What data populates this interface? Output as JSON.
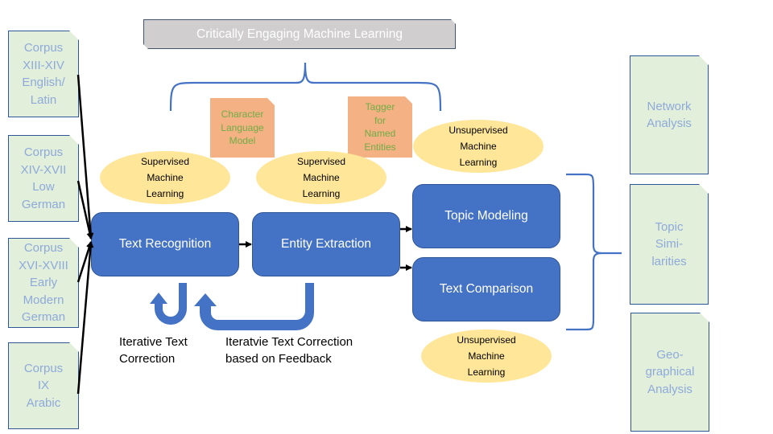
{
  "title_banner": "Critically Engaging Machine Learning",
  "corpora": [
    {
      "lines": [
        "Corpus",
        "XIII-XIV",
        "English/",
        "Latin"
      ]
    },
    {
      "lines": [
        "Corpus",
        "XIV-XVII",
        "Low",
        "German"
      ]
    },
    {
      "lines": [
        "Corpus",
        "XVI-XVIII",
        "Early",
        "Modern",
        "German"
      ]
    },
    {
      "lines": [
        "Corpus",
        "IX",
        "Arabic"
      ]
    }
  ],
  "models": [
    {
      "lines": [
        "Character",
        "Language",
        "Model"
      ]
    },
    {
      "lines": [
        "Tagger",
        "for",
        "Named",
        "Entities"
      ]
    }
  ],
  "ml_labels": {
    "supervised_1": [
      "Supervised",
      "Machine",
      "Learning"
    ],
    "supervised_2": [
      "Supervised",
      "Machine",
      "Learning"
    ],
    "unsupervised_1": [
      "Unsupervised",
      "Machine",
      "Learning"
    ],
    "unsupervised_2": [
      "Unsupervised",
      "Machine",
      "Learning"
    ]
  },
  "processes": {
    "text_recognition": "Text Recognition",
    "entity_extraction": "Entity Extraction",
    "topic_modeling": "Topic Modeling",
    "text_comparison": "Text Comparison"
  },
  "loops": {
    "iterative": [
      "Iterative Text",
      "Correction"
    ],
    "feedback": [
      "Iteratvie Text Correction",
      "based on Feedback"
    ]
  },
  "outputs": [
    {
      "lines": [
        "Network",
        "Analysis"
      ]
    },
    {
      "lines": [
        "Topic",
        "Simi-",
        "larities"
      ]
    },
    {
      "lines": [
        "Geo-",
        "graphical",
        "Analysis"
      ]
    }
  ],
  "colors": {
    "process_blue": "#4472c4",
    "ellipse_yellow": "#ffe699",
    "doc_green": "#e2efda",
    "doc_text": "#8eaadb",
    "model_orange": "#f4b183",
    "model_text": "#70ad47",
    "banner_gray": "#d0cece"
  }
}
